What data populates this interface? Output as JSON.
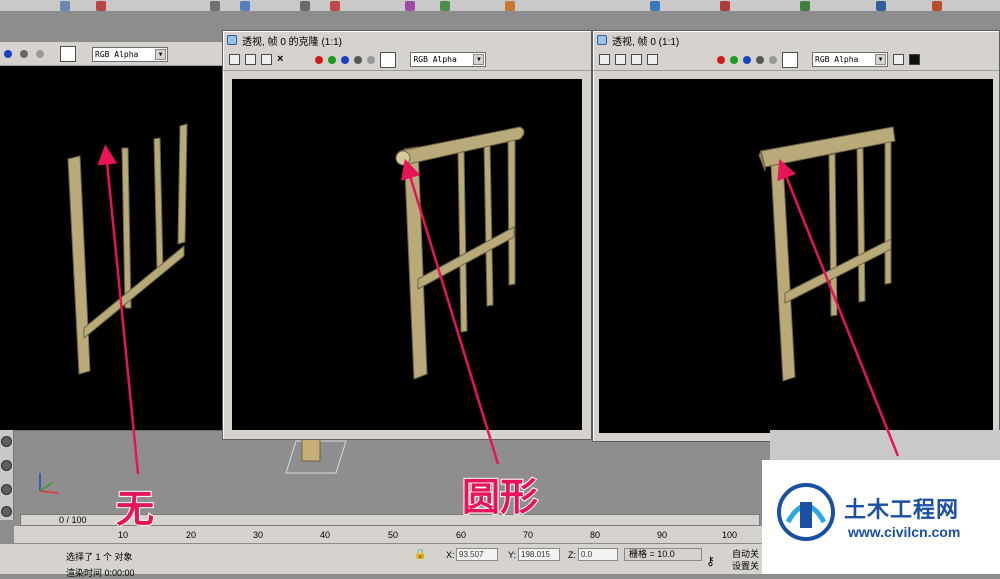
{
  "bg_viewport": {
    "channel_select": "RGB Alpha"
  },
  "window_clone": {
    "title": "透视, 帧 0 的克隆 (1:1)",
    "channel_select": "RGB Alpha",
    "toolbar_icons": [
      "save-icon",
      "copy-icon",
      "print-icon",
      "close-icon"
    ]
  },
  "window_main": {
    "title": "透视, 帧 0 (1:1)",
    "channel_select": "RGB Alpha",
    "toolbar_icons": [
      "save-icon",
      "copy-icon",
      "clone-icon",
      "print-icon"
    ]
  },
  "annotations": {
    "none_label": "无",
    "round_label": "圆形"
  },
  "timeline": {
    "frame_counter": "0 / 100",
    "ticks": [
      "10",
      "20",
      "30",
      "40",
      "50",
      "60",
      "70",
      "80",
      "90",
      "100"
    ]
  },
  "status_bar": {
    "prompt": "选择了 1 个 对象",
    "sub_prompt": "渲染时间 0:00:00",
    "x_label": "X:",
    "x_value": "93.507",
    "y_label": "Y:",
    "y_value": "198.015",
    "z_label": "Z:",
    "z_value": "0.0",
    "grid": "栅格 = 10.0",
    "auto_key": "自动关",
    "set_key": "设置关"
  },
  "watermark": {
    "title": "土木工程网",
    "url": "www.civilcn.com"
  },
  "colors": {
    "accent": "#e8145a",
    "fence": "#b9aa79",
    "brand": "#1a4fa3"
  }
}
